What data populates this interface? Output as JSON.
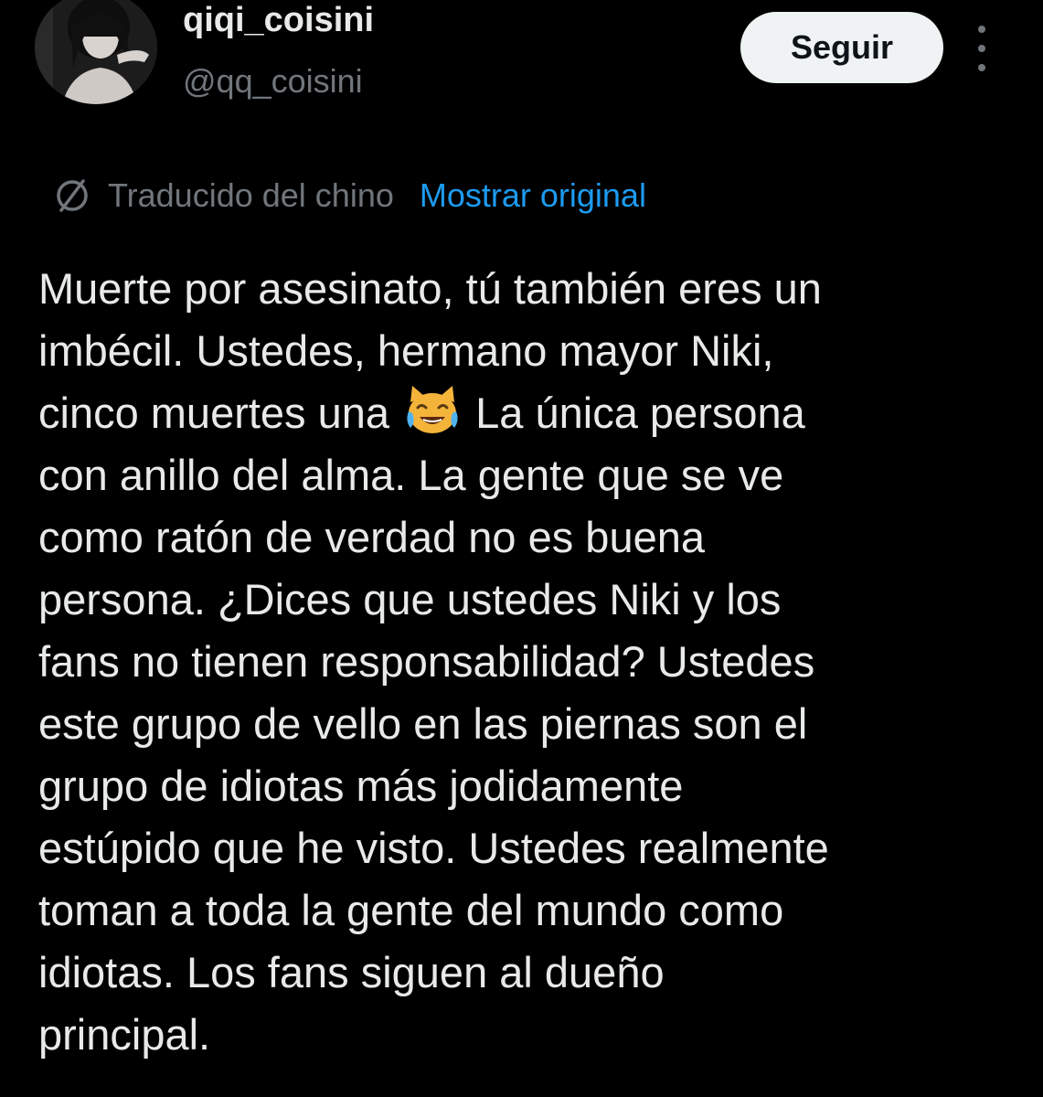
{
  "author": {
    "display_name": "qiqi_coisini",
    "handle": "@qq_coisini",
    "avatar_icon": "user-avatar-photo"
  },
  "actions": {
    "follow_label": "Seguir",
    "more_icon": "more-vertical-icon"
  },
  "translation": {
    "icon": "translate-icon",
    "label": "Traducido del chino",
    "show_original_label": "Mostrar original"
  },
  "tweet": {
    "line_1": "Muerte por asesinato, tú también eres un",
    "line_2": "imbécil. Ustedes, hermano mayor Niki,",
    "line_3_before_emoji": "cinco muertes una",
    "emoji": "cat-with-tears-of-joy",
    "line_3_after_emoji": "La única persona",
    "line_4": "con anillo del alma. La gente que se ve",
    "line_5": "como ratón de verdad no es buena",
    "line_6": "persona. ¿Dices que ustedes Niki y los",
    "line_7": "fans no tienen responsabilidad? Ustedes",
    "line_8": "este grupo de vello en las piernas son el",
    "line_9": "grupo de idiotas más jodidamente",
    "line_10": "estúpido que he visto. Ustedes realmente",
    "line_11": "toman a toda la gente del mundo como",
    "line_12": "idiotas. Los fans siguen al dueño",
    "line_13": "principal."
  },
  "colors": {
    "background": "#000000",
    "text_primary": "#e7e9ea",
    "text_secondary": "#71767b",
    "link": "#1d9bf0",
    "button_bg": "#eff3f4"
  }
}
